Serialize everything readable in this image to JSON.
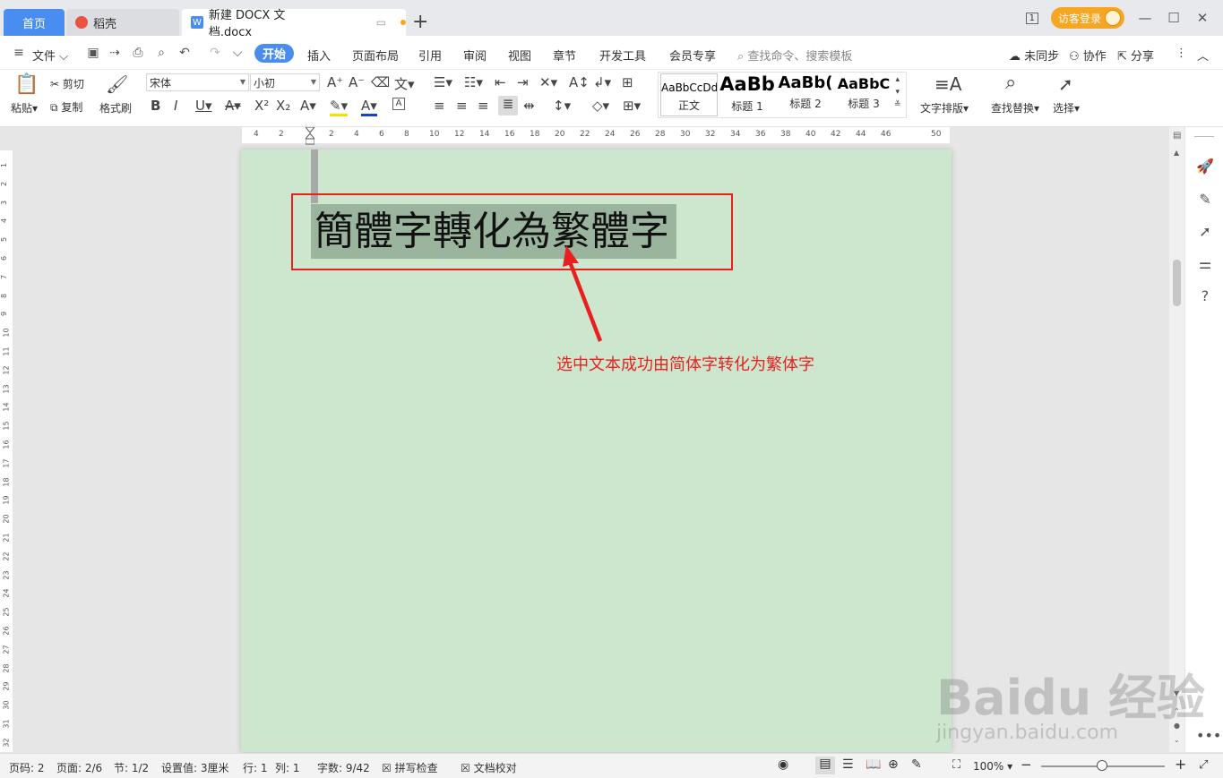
{
  "tabs": {
    "home": "首页",
    "daoke": "稻壳",
    "doc": "新建 DOCX 文档.docx"
  },
  "window": {
    "login": "访客登录"
  },
  "menu": {
    "file": "文件",
    "items": [
      "开始",
      "插入",
      "页面布局",
      "引用",
      "审阅",
      "视图",
      "章节",
      "开发工具",
      "会员专享"
    ],
    "search_placeholder": "查找命令、搜索模板",
    "sync": "未同步",
    "collab": "协作",
    "share": "分享"
  },
  "ribbon": {
    "paste": "粘贴",
    "cut": "剪切",
    "copy": "复制",
    "format_painter": "格式刷",
    "font_name": "宋体",
    "font_size": "小初",
    "styles": [
      {
        "sample": "AaBbCcDd",
        "name": "正文"
      },
      {
        "sample": "AaBb",
        "name": "标题 1"
      },
      {
        "sample": "AaBb(",
        "name": "标题 2"
      },
      {
        "sample": "AaBbC",
        "name": "标题 3"
      }
    ],
    "text_layout": "文字排版",
    "find_replace": "查找替换",
    "select": "选择"
  },
  "ruler": {
    "h_ticks": [
      "4",
      "2",
      "",
      "2",
      "4",
      "6",
      "8",
      "10",
      "12",
      "14",
      "16",
      "18",
      "20",
      "22",
      "24",
      "26",
      "28",
      "30",
      "32",
      "34",
      "36",
      "38",
      "40",
      "42",
      "44",
      "46",
      "",
      "50"
    ],
    "v_ticks": [
      "1",
      "2",
      "3",
      "4",
      "5",
      "6",
      "7",
      "8",
      "9",
      "10",
      "11",
      "12",
      "13",
      "14",
      "15",
      "16",
      "17",
      "18",
      "19",
      "20",
      "21",
      "22",
      "23",
      "24",
      "25",
      "26",
      "27",
      "28",
      "29",
      "30",
      "31",
      "32"
    ]
  },
  "document": {
    "selected_text": "簡體字轉化為繁體字",
    "annotation": "选中文本成功由简体字转化为繁体字"
  },
  "status": {
    "page_code": "页码: 2",
    "page": "页面: 2/6",
    "section": "节: 1/2",
    "setting": "设置值: 3厘米",
    "row": "行: 1",
    "col": "列: 1",
    "word_count": "字数: 9/42",
    "spell_check": "拼写检查",
    "doc_proof": "文档校对",
    "zoom": "100%"
  },
  "watermark": {
    "brand": "Baidu 经验",
    "url": "jingyan.baidu.com"
  }
}
